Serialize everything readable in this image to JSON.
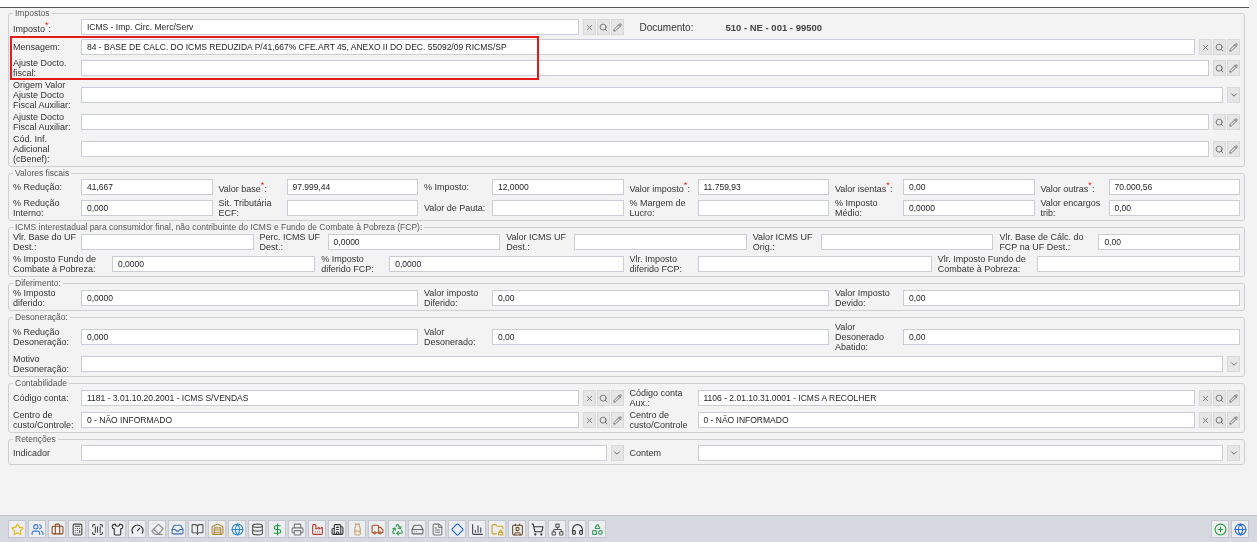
{
  "sections": [
    {
      "legend": "Impostos",
      "rows": [
        {
          "highlighted": false,
          "fields": [
            {
              "kind": "lookup",
              "label": "Imposto$^{*}$:",
              "value": "ICMS - Imp. Circ. Merc/Serv",
              "clearable": true
            },
            {
              "kind": "info",
              "label": "Documento:",
              "value": "510 - NE  - 001 - 99500"
            }
          ]
        },
        {
          "highlighted": true,
          "fields": [
            {
              "kind": "lookup",
              "label": "Mensagem:",
              "value": "84 - BASE DE CALC. DO ICMS REDUZIDA P/41,667% CFE.ART 45, ANEXO II DO DEC. 55092/09 RICMS/SP",
              "clearable": true
            }
          ]
        },
        {
          "highlighted": true,
          "fields": [
            {
              "kind": "lookup",
              "label": "Ajuste Docto. fiscal:",
              "clearable": false
            }
          ]
        },
        {
          "highlighted": false,
          "fields": [
            {
              "kind": "select",
              "label": "Origem Valor Ajuste Docto Fiscal Auxiliar:"
            }
          ]
        },
        {
          "highlighted": false,
          "fields": [
            {
              "kind": "lookup",
              "label": "Ajuste Docto Fiscal Auxiliar:",
              "clearable": false
            }
          ]
        },
        {
          "highlighted": false,
          "fields": [
            {
              "kind": "lookup",
              "label": "Cód. Inf. Adicional (cBenef):",
              "clearable": false
            }
          ]
        }
      ]
    },
    {
      "legend": "Valores fiscais",
      "rows": [
        {
          "highlighted": false,
          "fields": [
            {
              "kind": "input",
              "label": "% Redução:",
              "value": "41,667"
            },
            {
              "kind": "input",
              "label": "Valor base$^{*}$:",
              "value": "97.999,44"
            },
            {
              "kind": "input",
              "label": "% Imposto:",
              "value": "12,0000"
            },
            {
              "kind": "input",
              "label": "Valor imposto$^{*}$:",
              "value": "11.759,93"
            },
            {
              "kind": "input",
              "label": "Valor isentas$^{*}$:",
              "value": "0,00"
            },
            {
              "kind": "input",
              "label": "Valor outras$^{*}$:",
              "value": "70.000,56"
            }
          ]
        },
        {
          "highlighted": false,
          "fields": [
            {
              "kind": "input",
              "label": "% Redução Interno:",
              "value": "0,000"
            },
            {
              "kind": "input",
              "label": "Sit. Tributária ECF:"
            },
            {
              "kind": "input",
              "label": "Valor de Pauta:"
            },
            {
              "kind": "input",
              "label": "% Margem de Lucro:"
            },
            {
              "kind": "input",
              "label": "% Imposto Médio:",
              "value": "0,0000"
            },
            {
              "kind": "input",
              "label": "Valor encargos trib:",
              "value": "0,00"
            }
          ]
        }
      ]
    },
    {
      "legend": "ICMS interestadual para consumidor final, não contribuinte do ICMS e Fundo de Combate à Pobreza (FCP):",
      "rows": [
        {
          "highlighted": false,
          "fields": [
            {
              "kind": "input",
              "label": "Vlr. Base do UF Dest.:"
            },
            {
              "kind": "input",
              "label": "Perc. ICMS UF Dest.:",
              "value": "0,0000"
            },
            {
              "kind": "input",
              "label": "Valor ICMS UF Dest.:"
            },
            {
              "kind": "input",
              "label": "Valor ICMS UF Orig.:"
            },
            {
              "kind": "input",
              "label": "Vlr. Base de Cálc. do FCP na UF Dest.:",
              "value": "0,00"
            }
          ]
        },
        {
          "highlighted": false,
          "fields": [
            {
              "kind": "input",
              "label": "% Imposto Fundo de Combate à Pobreza:",
              "value": "0,0000"
            },
            {
              "kind": "input",
              "label": "% Imposto diferido FCP:",
              "value": "0,0000"
            },
            {
              "kind": "input",
              "label": "Vlr. Imposto diferido FCP:"
            },
            {
              "kind": "input",
              "label": "Vlr. Imposto Fundo de Combate à Pobreza:"
            }
          ]
        }
      ]
    },
    {
      "legend": "Diferimento:",
      "rows": [
        {
          "highlighted": false,
          "fields": [
            {
              "kind": "input",
              "label": "% Imposto diferido:",
              "value": "0,0000"
            },
            {
              "kind": "input",
              "label": "Valor imposto Diferido:",
              "value": "0,00"
            },
            {
              "kind": "input",
              "label": "Valor Imposto Devido:",
              "value": "0,00"
            }
          ]
        }
      ]
    },
    {
      "legend": "Desoneração:",
      "rows": [
        {
          "highlighted": false,
          "fields": [
            {
              "kind": "input",
              "label": "% Redução Desoneração:",
              "value": "0,000"
            },
            {
              "kind": "input",
              "label": "Valor Desonerado:",
              "value": "0,00"
            },
            {
              "kind": "input",
              "label": "Valor Desonerado Abatido:",
              "value": "0,00"
            }
          ]
        },
        {
          "highlighted": false,
          "fields": [
            {
              "kind": "select",
              "label": "Motivo Desoneração:"
            }
          ]
        }
      ]
    },
    {
      "legend": "Contabilidade",
      "rows": [
        {
          "highlighted": false,
          "fields": [
            {
              "kind": "lookup",
              "label": "Código conta:",
              "value": "1181 - 3.01.10.20.2001 - ICMS S/VENDAS",
              "clearable": true
            },
            {
              "kind": "lookup",
              "label": "Código conta Aux.:",
              "value": "1106 - 2.01.10.31.0001 - ICMS A RECOLHER",
              "clearable": true
            }
          ]
        },
        {
          "highlighted": false,
          "fields": [
            {
              "kind": "lookup",
              "label": "Centro de custo/Controle:",
              "value": "0 - NÃO INFORMADO",
              "clearable": true
            },
            {
              "kind": "lookup",
              "label": "Centro de custo/Controle",
              "value": "0 - NÃO INFORMADO",
              "clearable": true
            }
          ]
        }
      ]
    },
    {
      "legend": "Retenções",
      "rows": [
        {
          "highlighted": false,
          "fields": [
            {
              "kind": "select",
              "label": "Indicador"
            },
            {
              "kind": "select",
              "label": "Contem"
            }
          ]
        }
      ]
    }
  ]
}
